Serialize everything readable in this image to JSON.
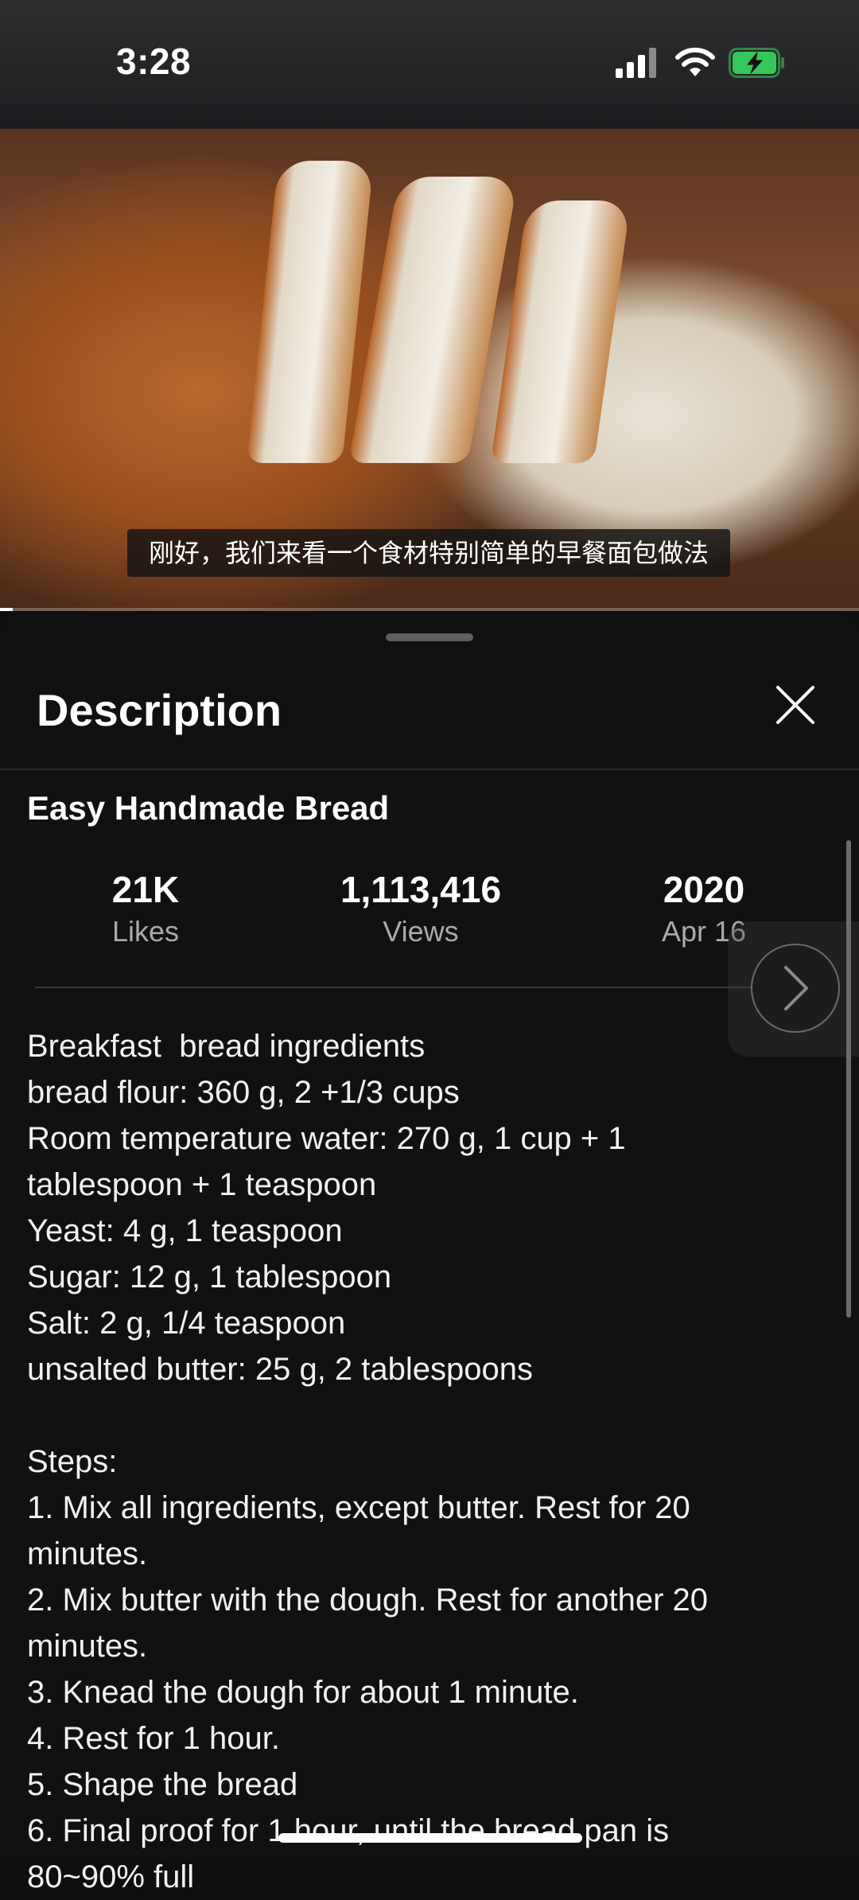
{
  "status_bar": {
    "time": "3:28"
  },
  "video": {
    "subtitle": "刚好，我们来看一个食材特别简单的早餐面包做法",
    "progress": 0.015
  },
  "sheet": {
    "title": "Description",
    "video_title": "Easy Handmade Bread",
    "stats": {
      "likes_value": "21K",
      "likes_label": "Likes",
      "views_value": "1,113,416",
      "views_label": "Views",
      "year_value": "2020",
      "date_label": "Apr 16"
    },
    "description": "Breakfast  bread ingredients\nbread flour: 360 g, 2 +1/3 cups\nRoom temperature water: 270 g, 1 cup + 1\ntablespoon + 1 teaspoon\nYeast: 4 g, 1 teaspoon\nSugar: 12 g, 1 tablespoon\nSalt: 2 g, 1/4 teaspoon\nunsalted butter: 25 g, 2 tablespoons\n\nSteps:\n1. Mix all ingredients, except butter. Rest for 20\nminutes.\n2. Mix butter with the dough. Rest for another 20\nminutes.\n3. Knead the dough for about 1 minute.\n4. Rest for 1 hour.\n5. Shape the bread\n6. Final proof for 1 hour, until the bread pan is\n80~90% full"
  },
  "icons": {
    "close": "close-icon",
    "next": "chevron-right-icon",
    "signal": "cellular-signal-icon",
    "wifi": "wifi-icon",
    "battery": "battery-charging-icon"
  },
  "colors": {
    "background": "#0f0f0f",
    "battery_green": "#35c759",
    "secondary_text": "#aaaaaa"
  }
}
